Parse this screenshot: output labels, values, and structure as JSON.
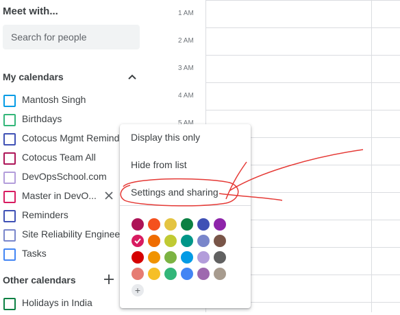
{
  "sidebar": {
    "meet_title": "Meet with...",
    "search_placeholder": "Search for people",
    "my_calendars_title": "My calendars",
    "my_calendars": [
      {
        "label": "Mantosh Singh",
        "color": "#039be5"
      },
      {
        "label": "Birthdays",
        "color": "#33b679"
      },
      {
        "label": "Cotocus Mgmt Remind",
        "color": "#3f51b5"
      },
      {
        "label": "Cotocus Team All",
        "color": "#ad1457"
      },
      {
        "label": "DevOpsSchool.com",
        "color": "#b39ddb"
      },
      {
        "label": "Master in DevO...",
        "color": "#d81b60"
      },
      {
        "label": "Reminders",
        "color": "#3f51b5"
      },
      {
        "label": "Site Reliability Engineer",
        "color": "#7986cb"
      },
      {
        "label": "Tasks",
        "color": "#4285f4"
      }
    ],
    "other_calendars_title": "Other calendars",
    "other_calendars": [
      {
        "label": "Holidays in India",
        "color": "#0b8043"
      }
    ]
  },
  "grid": {
    "times": [
      "1 AM",
      "2 AM",
      "3 AM",
      "4 AM",
      "5 AM"
    ]
  },
  "menu": {
    "items": [
      "Display this only",
      "Hide from list",
      "Settings and sharing"
    ],
    "colors": [
      "#ad1457",
      "#f4511e",
      "#e4c441",
      "#0b8043",
      "#3f51b5",
      "#8e24aa",
      "#d81b60",
      "#ef6c00",
      "#c0ca33",
      "#009688",
      "#7986cb",
      "#795548",
      "#d50000",
      "#f09300",
      "#7cb342",
      "#039be5",
      "#b39ddb",
      "#616161",
      "#e67c73",
      "#f6bf26",
      "#33b679",
      "#4285f4",
      "#9e69af",
      "#a79b8e"
    ],
    "selected_color_index": 6,
    "add_symbol": "+"
  },
  "annotation_color": "#e53935"
}
